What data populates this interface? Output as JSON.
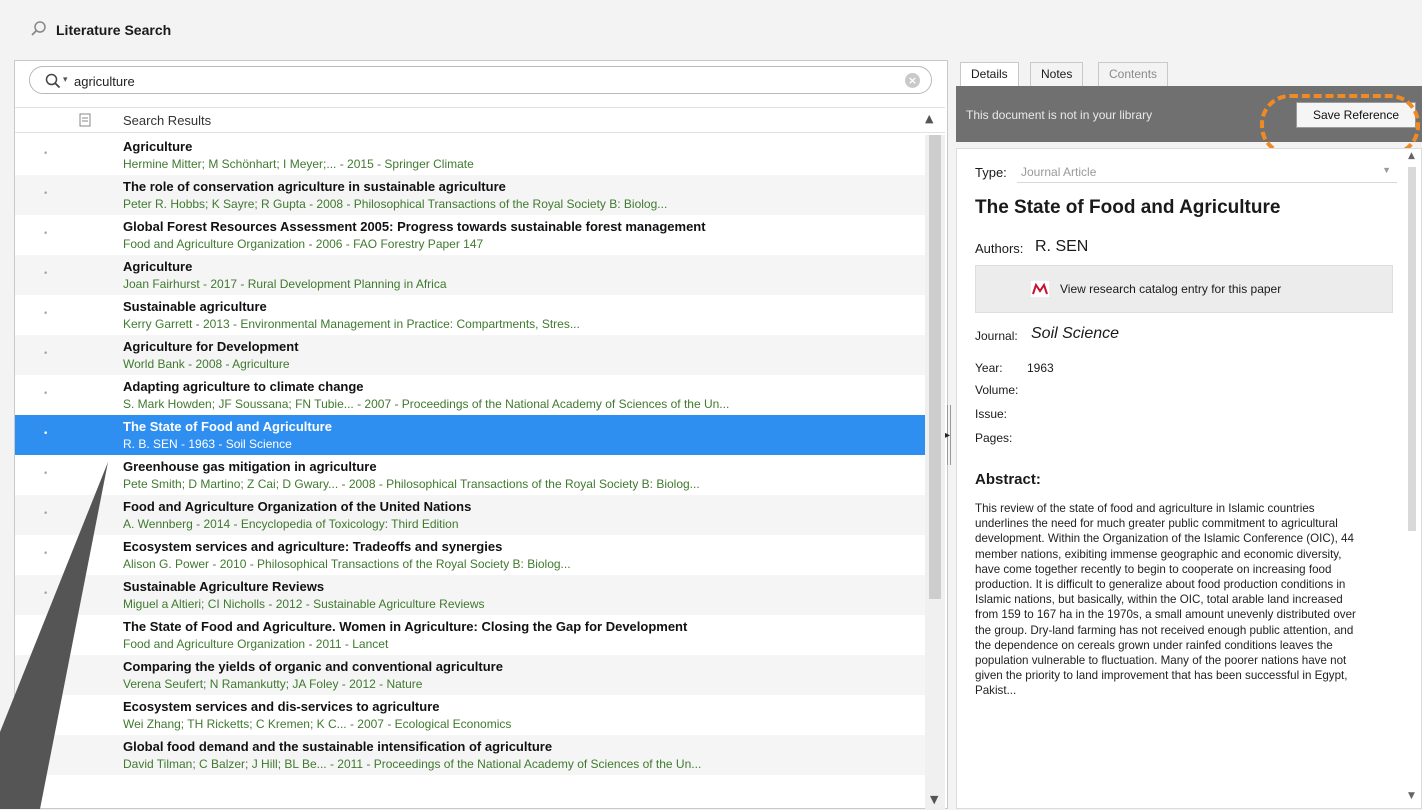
{
  "window": {
    "title": "Literature Search"
  },
  "search": {
    "value": "agriculture",
    "dropdown_glyph": "▾",
    "clear_glyph": "×"
  },
  "list_header": {
    "label": "Search Results"
  },
  "results": [
    {
      "title": "Agriculture",
      "meta": "Hermine Mitter; M Schönhart; I Meyer;... - 2015 - Springer Climate"
    },
    {
      "title": "The role of conservation agriculture in sustainable agriculture",
      "meta": "Peter R. Hobbs; K Sayre; R Gupta - 2008 - Philosophical Transactions of the Royal Society B: Biolog..."
    },
    {
      "title": "Global Forest Resources Assessment 2005: Progress towards sustainable forest management",
      "meta": "Food and Agriculture Organization - 2006 - FAO Forestry Paper 147"
    },
    {
      "title": "Agriculture",
      "meta": "Joan Fairhurst - 2017 - Rural Development Planning in Africa"
    },
    {
      "title": "Sustainable agriculture",
      "meta": "Kerry Garrett - 2013 - Environmental Management in Practice: Compartments, Stres..."
    },
    {
      "title": "Agriculture for Development",
      "meta": "World Bank - 2008 - Agriculture"
    },
    {
      "title": "Adapting agriculture to climate change",
      "meta": "S. Mark Howden; JF Soussana; FN Tubie... - 2007 - Proceedings of the National Academy of Sciences of the Un..."
    },
    {
      "title": "The State of Food and Agriculture",
      "meta": "R. B. SEN - 1963 - Soil Science"
    },
    {
      "title": "Greenhouse gas mitigation in agriculture",
      "meta": "Pete Smith; D Martino; Z Cai; D Gwary... - 2008 - Philosophical Transactions of the Royal Society B: Biolog..."
    },
    {
      "title": "Food and Agriculture Organization of the United Nations",
      "meta": "A. Wennberg - 2014 - Encyclopedia of Toxicology: Third Edition"
    },
    {
      "title": "Ecosystem services and agriculture: Tradeoffs and synergies",
      "meta": "Alison G. Power - 2010 - Philosophical Transactions of the Royal Society B: Biolog..."
    },
    {
      "title": "Sustainable Agriculture Reviews",
      "meta": "Miguel a Altieri; CI Nicholls - 2012 - Sustainable Agriculture Reviews"
    },
    {
      "title": "The State of Food and Agriculture. Women in Agriculture: Closing the Gap for Development",
      "meta": "Food and Agriculture Organization - 2011 - Lancet"
    },
    {
      "title": "Comparing the yields of organic and conventional agriculture",
      "meta": "Verena Seufert; N Ramankutty; JA Foley - 2012 - Nature"
    },
    {
      "title": "Ecosystem services and dis-services to agriculture",
      "meta": "Wei Zhang; TH Ricketts; C Kremen; K C... - 2007 - Ecological Economics"
    },
    {
      "title": "Global food demand and the sustainable intensification of agriculture",
      "meta": "David Tilman; C Balzer; J Hill; BL Be... - 2011 - Proceedings of the National Academy of Sciences of the Un..."
    }
  ],
  "selected_index": 7,
  "tabs": [
    {
      "label": "Details",
      "state": "active"
    },
    {
      "label": "Notes",
      "state": "normal"
    },
    {
      "label": "Contents",
      "state": "disabled"
    }
  ],
  "banner": {
    "text": "This document is not in your library",
    "save_label": "Save Reference"
  },
  "details": {
    "type_label": "Type:",
    "type_value": "Journal Article",
    "title": "The State of Food and Agriculture",
    "authors_label": "Authors:",
    "authors_value": "R. SEN",
    "catalog_label": "View research catalog entry for this paper",
    "journal_label": "Journal:",
    "journal_value": "Soil Science",
    "year_label": "Year:",
    "year_value": "1963",
    "volume_label": "Volume:",
    "issue_label": "Issue:",
    "pages_label": "Pages:",
    "abstract_heading": "Abstract:",
    "abstract_text": "This review of the state of food and agriculture in Islamic countries underlines the need for much greater public commitment to agricultural development. Within the Organization of the Islamic Conference (OIC), 44 member nations, exibiting immense geographic and economic diversity, have come together recently to begin to cooperate on increasing food production. It is difficult to generalize about food production conditions in Islamic nations, but basically, within the OIC, total arable land increased from 159 to 167 ha in the 1970s, a small amount unevenly distributed over the group. Dry-land farming has not received enough public attention, and the dependence on cereals grown under rainfed conditions leaves the population vulnerable to fluctuation. Many of the poorer nations have not given the priority to land improvement that has been successful in Egypt, Pakist..."
  },
  "colors": {
    "selection": "#2f8ff0",
    "meta_text": "#3f7a2e",
    "banner": "#707070",
    "highlight": "#f08a24"
  }
}
